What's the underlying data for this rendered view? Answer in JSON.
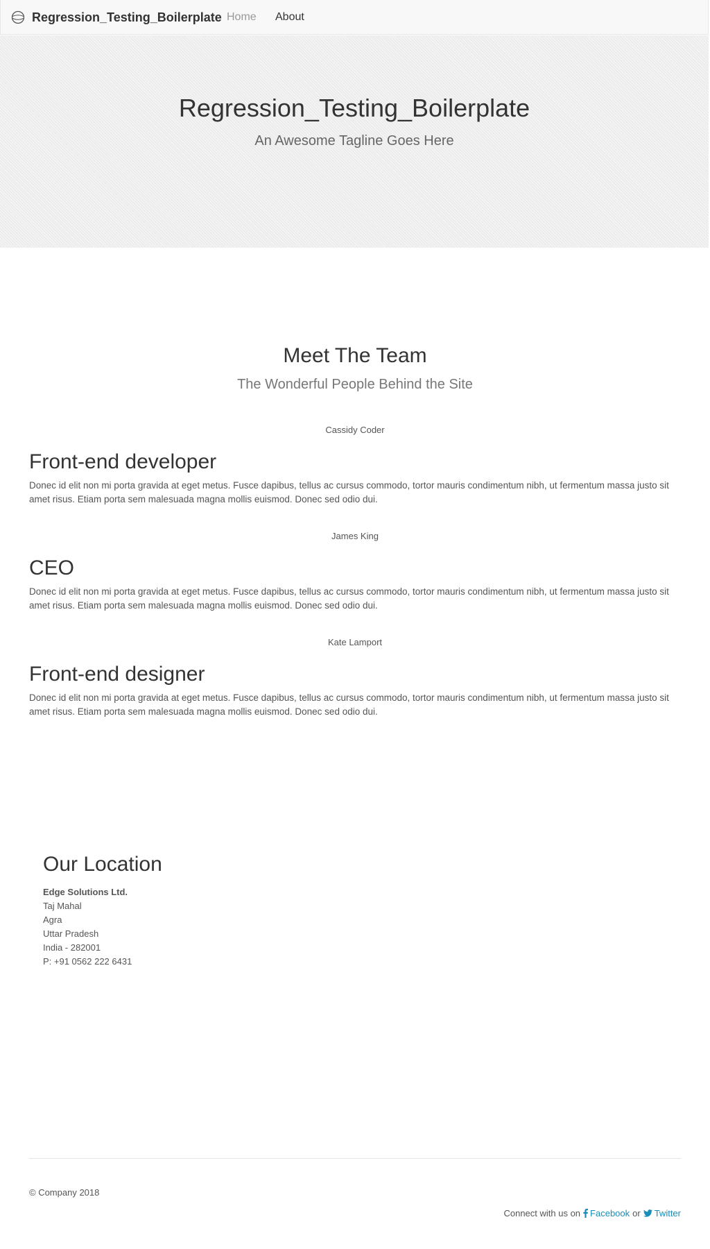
{
  "navbar": {
    "brand": "Regression_Testing_Boilerplate",
    "links": [
      {
        "label": "Home"
      },
      {
        "label": "About"
      }
    ]
  },
  "hero": {
    "title": "Regression_Testing_Boilerplate",
    "tagline": "An Awesome Tagline Goes Here"
  },
  "team": {
    "title": "Meet The Team",
    "subtitle": "The Wonderful People Behind the Site",
    "members": [
      {
        "name": "Cassidy Coder",
        "role": "Front-end developer",
        "bio": "Donec id elit non mi porta gravida at eget metus. Fusce dapibus, tellus ac cursus commodo, tortor mauris condimentum nibh, ut fermentum massa justo sit amet risus. Etiam porta sem malesuada magna mollis euismod. Donec sed odio dui."
      },
      {
        "name": "James King",
        "role": "CEO",
        "bio": "Donec id elit non mi porta gravida at eget metus. Fusce dapibus, tellus ac cursus commodo, tortor mauris condimentum nibh, ut fermentum massa justo sit amet risus. Etiam porta sem malesuada magna mollis euismod. Donec sed odio dui."
      },
      {
        "name": "Kate Lamport",
        "role": "Front-end designer",
        "bio": "Donec id elit non mi porta gravida at eget metus. Fusce dapibus, tellus ac cursus commodo, tortor mauris condimentum nibh, ut fermentum massa justo sit amet risus. Etiam porta sem malesuada magna mollis euismod. Donec sed odio dui."
      }
    ]
  },
  "location": {
    "title": "Our Location",
    "company": "Edge Solutions Ltd.",
    "lines": [
      "Taj Mahal",
      "Agra",
      "Uttar Pradesh",
      "India - 282001",
      "P: +91 0562 222 6431"
    ]
  },
  "footer": {
    "copyright": "© Company 2018",
    "connect_text": "Connect with us on",
    "or_text": "or",
    "facebook_label": "Facebook",
    "twitter_label": "Twitter",
    "link_color": "#1a8cb8"
  },
  "icons": {
    "brand": "globe-icon",
    "facebook": "facebook-icon",
    "twitter": "twitter-icon"
  }
}
